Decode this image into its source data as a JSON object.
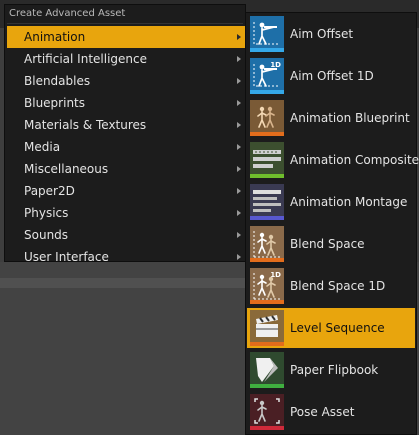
{
  "menu": {
    "header": "Create Advanced Asset",
    "items": [
      {
        "label": "Animation",
        "active": true
      },
      {
        "label": "Artificial Intelligence"
      },
      {
        "label": "Blendables"
      },
      {
        "label": "Blueprints"
      },
      {
        "label": "Materials & Textures"
      },
      {
        "label": "Media"
      },
      {
        "label": "Miscellaneous"
      },
      {
        "label": "Paper2D"
      },
      {
        "label": "Physics"
      },
      {
        "label": "Sounds"
      },
      {
        "label": "User Interface"
      }
    ]
  },
  "submenu": {
    "items": [
      {
        "label": "Aim Offset",
        "icon": "aim-offset-icon",
        "bg": "#1e6fa8",
        "stripe": "#35a8e8"
      },
      {
        "label": "Aim Offset 1D",
        "icon": "aim-offset-1d-icon",
        "bg": "#1e6fa8",
        "stripe": "#35a8e8",
        "badge": "1D"
      },
      {
        "label": "Animation Blueprint",
        "icon": "animation-blueprint-icon",
        "bg": "#7a5a36",
        "stripe": "#e26d1c"
      },
      {
        "label": "Animation Composite",
        "icon": "animation-composite-icon",
        "bg": "#3c4f2f",
        "stripe": "#6fbe2c"
      },
      {
        "label": "Animation Montage",
        "icon": "animation-montage-icon",
        "bg": "#3a3a52",
        "stripe": "#5858d0"
      },
      {
        "label": "Blend Space",
        "icon": "blend-space-icon",
        "bg": "#8a6a4a",
        "stripe": "#e26d1c"
      },
      {
        "label": "Blend Space 1D",
        "icon": "blend-space-1d-icon",
        "bg": "#8a6a4a",
        "stripe": "#e26d1c",
        "badge": "1D"
      },
      {
        "label": "Level Sequence",
        "icon": "level-sequence-icon",
        "bg": "#8a6a3a",
        "stripe": "#e26d1c",
        "active": true
      },
      {
        "label": "Paper Flipbook",
        "icon": "paper-flipbook-icon",
        "bg": "#2f4a2f",
        "stripe": "#3fae3f"
      },
      {
        "label": "Pose Asset",
        "icon": "pose-asset-icon",
        "bg": "#4a1f24",
        "stripe": "#d02a3a"
      }
    ]
  }
}
